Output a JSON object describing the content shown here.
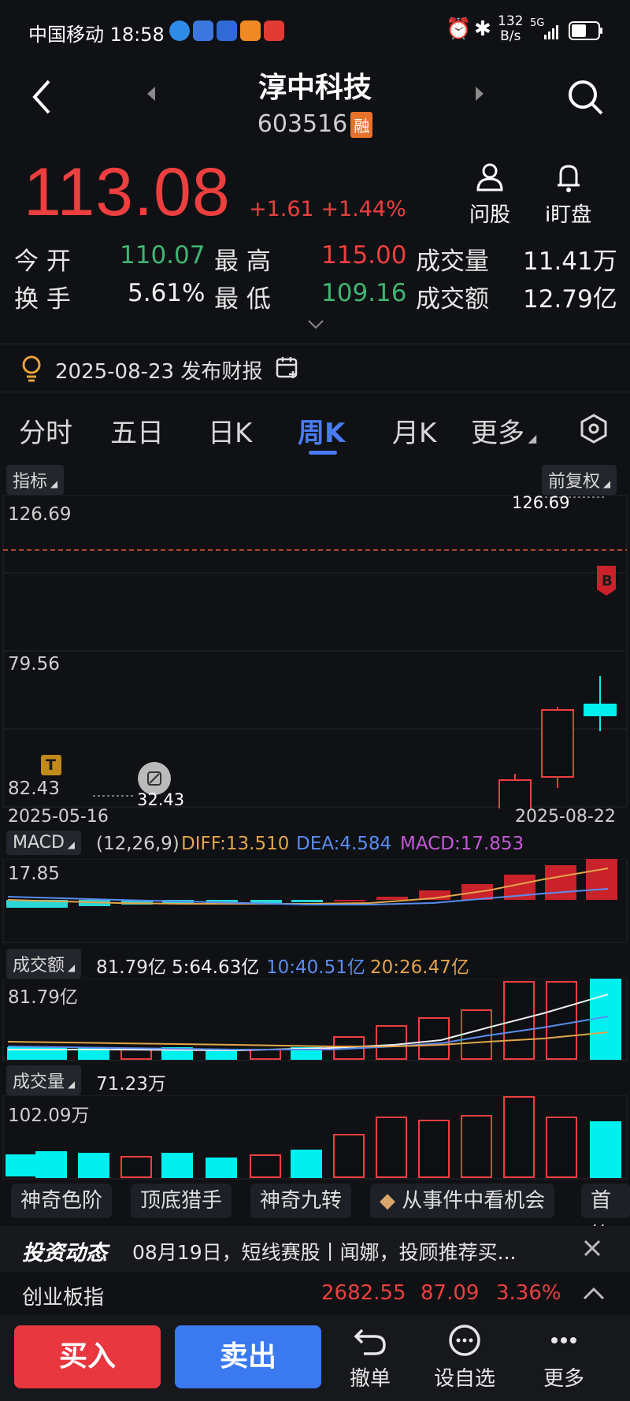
{
  "status_bar": {
    "carrier_time": "中国移动 18:58",
    "net_speed_top": "132",
    "net_speed_bottom": "B/s",
    "signal": "5G"
  },
  "header": {
    "title": "淳中科技",
    "code": "603516",
    "margin_badge": "融"
  },
  "quote": {
    "price": "113.08",
    "change": "+1.61",
    "change_pct": "+1.44%",
    "ask_label": "问股",
    "watch_label": "i盯盘",
    "stats": [
      {
        "label": "今 开",
        "value": "110.07",
        "tone": "green"
      },
      {
        "label": "最 高",
        "value": "115.00",
        "tone": "red"
      },
      {
        "label": "成交量",
        "value": "11.41万",
        "tone": "white"
      },
      {
        "label": "换 手",
        "value": "5.61%",
        "tone": "white"
      },
      {
        "label": "最 低",
        "value": "109.16",
        "tone": "green"
      },
      {
        "label": "成交额",
        "value": "12.79亿",
        "tone": "white"
      }
    ],
    "earnings_notice": "2025-08-23 发布财报"
  },
  "tabs": [
    "分时",
    "五日",
    "日K",
    "周K",
    "月K",
    "更多"
  ],
  "active_tab": "周K",
  "kline": {
    "indicator_label": "指标",
    "adjust_label": "前复权",
    "y_top_label": "126.69",
    "y_mid_label": "79.56",
    "y_low_label": "82.43",
    "max_label": "126.69",
    "min_label": "32.43",
    "start_date": "2025-05-16",
    "end_date": "2025-08-22",
    "t_marker": "T",
    "b_marker": "B"
  },
  "macd": {
    "label": "MACD",
    "params": "(12,26,9)",
    "diff": "DIFF:13.510",
    "dea": "DEA:4.584",
    "macd": "MACD:17.853",
    "scale": "17.85"
  },
  "turnover": {
    "label": "成交额",
    "value": "81.79亿",
    "ma5": "5:64.63亿",
    "ma10": "10:40.51亿",
    "ma20": "20:26.47亿",
    "scale": "81.79亿"
  },
  "volume": {
    "label": "成交量",
    "value": "71.23万",
    "scale": "102.09万"
  },
  "chips": [
    "神奇色阶",
    "顶底猎手",
    "神奇九转",
    "从事件中看机会",
    "首签"
  ],
  "news": {
    "brand": "投资动态",
    "text": "08月19日，短线赛股丨闻娜，投顾推荐买..."
  },
  "index_bar": {
    "name": "创业板指",
    "value": "2682.55",
    "change": "87.09",
    "pct": "3.36%"
  },
  "actions": {
    "buy": "买入",
    "sell": "卖出",
    "cancel": "撤单",
    "watchlist": "设自选",
    "more": "更多"
  },
  "colors": {
    "up": "#ee3f3f",
    "down": "#00f0f0",
    "accent": "#4a7bf7",
    "buy": "#e8373f",
    "sell": "#3a79f0"
  }
}
